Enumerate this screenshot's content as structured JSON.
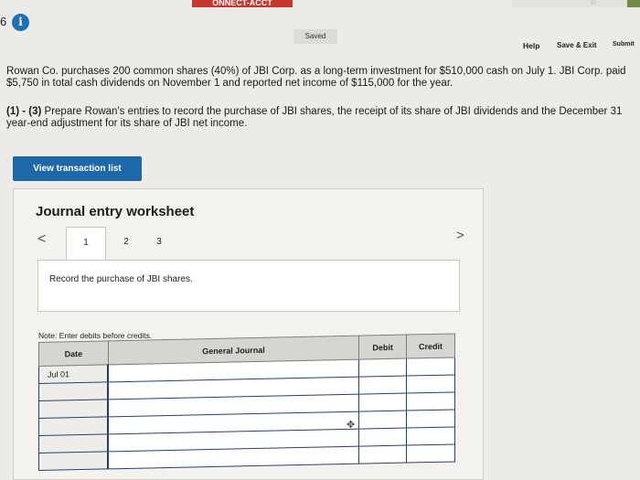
{
  "top_bar": {
    "brand_text": "ONNECT-ACCT"
  },
  "question_number": "6",
  "status": {
    "saved_label": "Saved"
  },
  "header_links": {
    "help": "Help",
    "save_exit": "Save & Exit",
    "submit": "Submit"
  },
  "question": {
    "paragraph1": "Rowan Co. purchases 200 common shares (40%) of JBI Corp. as a long-term investment for $510,000 cash on July 1. JBI Corp. paid $5,750 in total cash dividends on November 1 and reported net income of $115,000 for the year.",
    "paragraph2_prefix": "(1) - (3)",
    "paragraph2_text": " Prepare Rowan's entries to record the purchase of JBI shares, the receipt of its share of JBI dividends and the December 31 year-end adjustment for its share of JBI net income."
  },
  "view_transaction_list_label": "View transaction list",
  "worksheet": {
    "title": "Journal entry worksheet",
    "tabs": [
      "1",
      "2",
      "3"
    ],
    "active_tab": "1",
    "instruction": "Record the purchase of JBI shares.",
    "note": "Note: Enter debits before credits.",
    "columns": {
      "date": "Date",
      "general_journal": "General Journal",
      "debit": "Debit",
      "credit": "Credit"
    },
    "rows": [
      {
        "date": "Jul 01",
        "account": "",
        "debit": "",
        "credit": ""
      },
      {
        "date": "",
        "account": "",
        "debit": "",
        "credit": ""
      },
      {
        "date": "",
        "account": "",
        "debit": "",
        "credit": ""
      },
      {
        "date": "",
        "account": "",
        "debit": "",
        "credit": ""
      },
      {
        "date": "",
        "account": "",
        "debit": "",
        "credit": ""
      },
      {
        "date": "",
        "account": "",
        "debit": "",
        "credit": ""
      }
    ]
  },
  "icons": {
    "info": "info-icon",
    "nav_prev": "chevron-left-icon",
    "nav_next": "chevron-right-icon",
    "move": "move-cursor-icon",
    "star": "star-icon"
  },
  "colors": {
    "accent_blue": "#1e67a8",
    "brand_red": "#c7362f",
    "table_border": "#24426b"
  }
}
